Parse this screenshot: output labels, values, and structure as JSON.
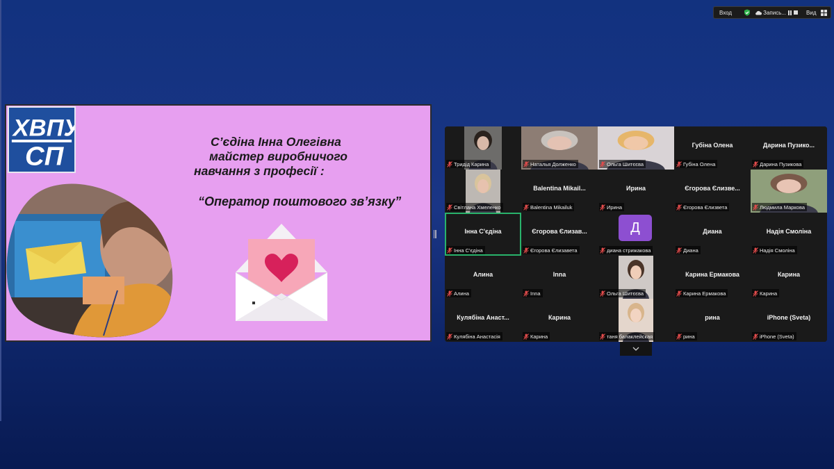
{
  "toolbar": {
    "view_label": "Вход",
    "record_label": "Запись...",
    "vid_label": "Вид",
    "icons": [
      "shield-check-icon",
      "cloud-icon",
      "pause-icon",
      "stop-icon",
      "grid-view-icon"
    ]
  },
  "slide": {
    "logo_text": "ХВПУ СП",
    "title_line1": "С’єдіна Інна Олегівна",
    "title_line2": "майстер виробничого",
    "title_line3": "навчання з професії :",
    "quote": "“Оператор поштового зв’язку”"
  },
  "gallery": {
    "tiles": [
      {
        "display": "",
        "label": "Тридід Карина",
        "video": true
      },
      {
        "display": "",
        "label": "Наталья Долженко",
        "video": true
      },
      {
        "display": "",
        "label": "Ольга Шитєєва",
        "video": true
      },
      {
        "display": "Губіна Олена",
        "label": "Губіна Олена",
        "video": false
      },
      {
        "display": "Дарина  Пузико...",
        "label": "Дарина Пузикова",
        "video": false
      },
      {
        "display": "",
        "label": "Світлана Хмеленко",
        "video": true
      },
      {
        "display": "Balentina  Mikail...",
        "label": "Balentina Mikailuk",
        "video": false
      },
      {
        "display": "Ирина",
        "label": "Ирина",
        "video": false
      },
      {
        "display": "Єгорова  Єлизве...",
        "label": "Єгорова Єлизвета",
        "video": false
      },
      {
        "display": "",
        "label": "Людмила Маркова",
        "video": true
      },
      {
        "display": "Інна С'єдіна",
        "label": "Інна С'єдіна",
        "video": false,
        "active": true
      },
      {
        "display": "Єгорова  Єлизав...",
        "label": "Єгорова Єлизавета",
        "video": false
      },
      {
        "display": "Д",
        "label": "диана стрижакова",
        "video": false,
        "avatar": true
      },
      {
        "display": "Диана",
        "label": "Диана",
        "video": false
      },
      {
        "display": "Надія Смоліна",
        "label": "Надія Смоліна",
        "video": false
      },
      {
        "display": "Алина",
        "label": "Алина",
        "video": false
      },
      {
        "display": "Inna",
        "label": "Inna",
        "video": false
      },
      {
        "display": "",
        "label": "Ольга Шитєєва",
        "video": true
      },
      {
        "display": "Карина Ермакова",
        "label": "Карина Ермакова",
        "video": false
      },
      {
        "display": "Карина",
        "label": "Карина",
        "video": false
      },
      {
        "display": "Кулябіна  Анаст...",
        "label": "Кулябіна Анастасія",
        "video": false
      },
      {
        "display": "Карина",
        "label": "Карина",
        "video": false
      },
      {
        "display": "",
        "label": "таня балаклейская",
        "video": true
      },
      {
        "display": "рина",
        "label": "рина",
        "video": false
      },
      {
        "display": "iPhone (Sveta)",
        "label": "iPhone (Sveta)",
        "video": false
      }
    ]
  },
  "colors": {
    "background": "#12327f",
    "slide_bg": "#e79ff0",
    "active_speaker": "#29b36b",
    "avatar": "#8d4fd1"
  }
}
